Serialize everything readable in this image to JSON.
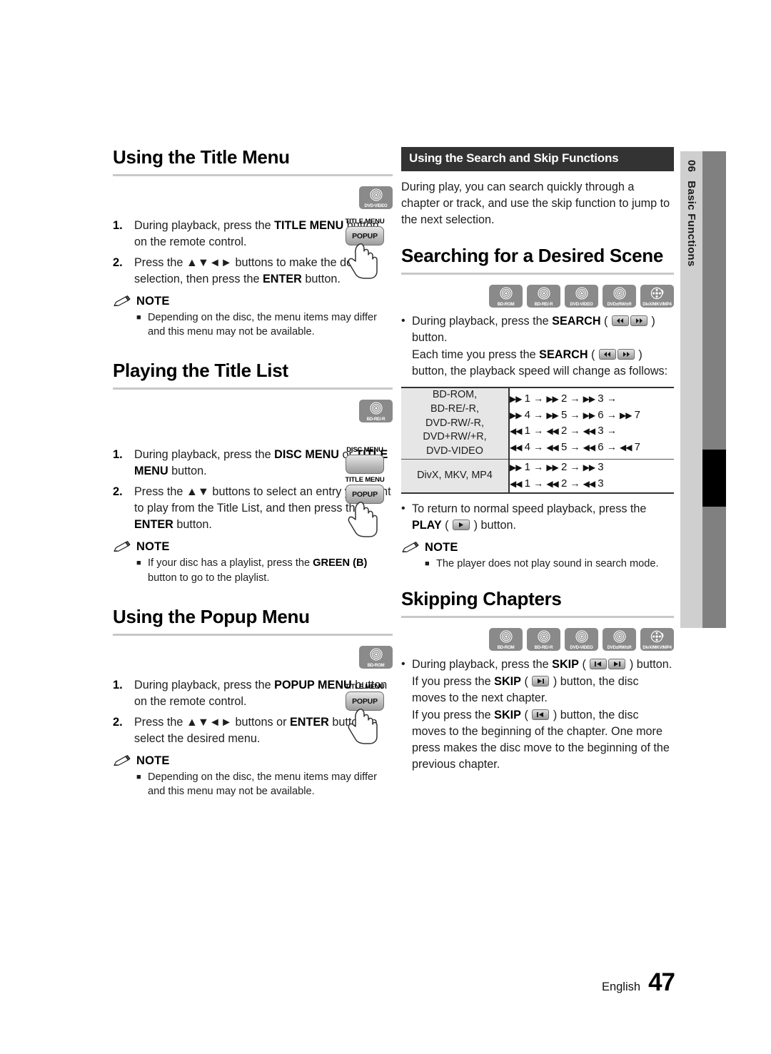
{
  "page": {
    "language": "English",
    "number": "47",
    "chapter_number": "06",
    "chapter_title": "Basic Functions"
  },
  "colors": {
    "banner_bg": "#333333",
    "rule": "#c8c8c8",
    "disc_icon_bg": "#8a8a8a",
    "side_tab_light": "#cfcfcf",
    "side_tab_dark": "#808080",
    "table_label_bg": "#e6e6e6"
  },
  "disc_icons": [
    {
      "name": "bd-rom",
      "caption": "BD-ROM"
    },
    {
      "name": "bd-re-r",
      "caption": "BD-RE/-R"
    },
    {
      "name": "dvd-video",
      "caption": "DVD-VIDEO"
    },
    {
      "name": "dvd-rw-r",
      "caption": "DVD±RW/±R"
    },
    {
      "name": "divx-mkv-mp4",
      "caption": "DivX/MKV/MP4"
    }
  ],
  "note_label": "NOTE",
  "left_column": {
    "section_title_menu": {
      "heading": "Using the Title Menu",
      "disc_icon_caption": "DVD-VIDEO",
      "remote": {
        "label": "TITLE MENU",
        "key": "POPUP"
      },
      "steps": [
        {
          "num": "1.",
          "parts": [
            {
              "t": "During playback, press the ",
              "b": false
            },
            {
              "t": "TITLE MENU",
              "b": true
            },
            {
              "t": " button on the remote control.",
              "b": false
            }
          ]
        },
        {
          "num": "2.",
          "parts": [
            {
              "t": "Press the ",
              "b": false
            },
            {
              "t": "▲▼◄►",
              "b": false
            },
            {
              "t": " buttons to make the desired selection, then press the ",
              "b": false
            },
            {
              "t": "ENTER",
              "b": true
            },
            {
              "t": " button.",
              "b": false
            }
          ]
        }
      ],
      "notes": [
        "Depending on the disc, the menu items may differ and this menu may not be available."
      ]
    },
    "section_title_list": {
      "heading": "Playing the Title List",
      "disc_icon_caption": "BD-RE/-R",
      "remote_top": {
        "label": "DISC MENU",
        "key": ""
      },
      "remote_bottom": {
        "label": "TITLE MENU",
        "key": "POPUP"
      },
      "steps": [
        {
          "num": "1.",
          "parts": [
            {
              "t": "During playback, press the ",
              "b": false
            },
            {
              "t": "DISC MENU",
              "b": true
            },
            {
              "t": " or ",
              "b": false
            },
            {
              "t": "TITLE MENU",
              "b": true
            },
            {
              "t": " button.",
              "b": false
            }
          ]
        },
        {
          "num": "2.",
          "parts": [
            {
              "t": "Press the ",
              "b": false
            },
            {
              "t": "▲▼",
              "b": false
            },
            {
              "t": " buttons to select an entry you want to play from the Title List, and then press the ",
              "b": false
            },
            {
              "t": "ENTER",
              "b": true
            },
            {
              "t": " button.",
              "b": false
            }
          ]
        }
      ],
      "notes_rich": [
        [
          {
            "t": "If your disc has a playlist, press the ",
            "b": false
          },
          {
            "t": "GREEN (B)",
            "b": true
          },
          {
            "t": " button to go to the playlist.",
            "b": false
          }
        ]
      ]
    },
    "section_popup_menu": {
      "heading": "Using the Popup Menu",
      "disc_icon_caption": "BD-ROM",
      "remote": {
        "label": "TITLE MENU",
        "key": "POPUP"
      },
      "steps": [
        {
          "num": "1.",
          "parts": [
            {
              "t": "During playback, press the ",
              "b": false
            },
            {
              "t": "POPUP MENU",
              "b": true
            },
            {
              "t": " button on the remote control.",
              "b": false
            }
          ]
        },
        {
          "num": "2.",
          "parts": [
            {
              "t": "Press the ",
              "b": false
            },
            {
              "t": "▲▼◄►",
              "b": false
            },
            {
              "t": " buttons or ",
              "b": false
            },
            {
              "t": "ENTER",
              "b": true
            },
            {
              "t": " button to select the desired menu.",
              "b": false
            }
          ]
        }
      ],
      "notes": [
        "Depending on the disc, the menu items may differ and this menu may not be available."
      ]
    }
  },
  "right_column": {
    "banner": "Using the Search and Skip Functions",
    "intro": "During play, you can search quickly through a chapter or track, and use the skip function to jump to the next selection.",
    "section_search": {
      "heading": "Searching for a Desired Scene",
      "bullet_1": [
        {
          "t": "During playback, press the ",
          "b": false
        },
        {
          "t": "SEARCH",
          "b": true
        },
        {
          "t": " ( ",
          "b": false
        },
        {
          "t": "[rew][ffw]",
          "b": false
        },
        {
          "t": " ) button.",
          "b": false
        }
      ],
      "sub_1": [
        {
          "t": "Each time you press the ",
          "b": false
        },
        {
          "t": "SEARCH",
          "b": true
        },
        {
          "t": " ( ",
          "b": false
        },
        {
          "t": "[rew][ffw]",
          "b": false
        },
        {
          "t": " ) button, the playback speed will change as follows:",
          "b": false
        }
      ],
      "bullet_2": [
        {
          "t": "To return to normal speed playback, press the ",
          "b": false
        },
        {
          "t": "PLAY",
          "b": true
        },
        {
          "t": " ( ",
          "b": false
        },
        {
          "t": "[play]",
          "b": false
        },
        {
          "t": " ) button.",
          "b": false
        }
      ],
      "notes": [
        "The player does not play sound in search mode."
      ]
    },
    "section_skip": {
      "heading": "Skipping Chapters",
      "bullet_1": [
        {
          "t": "During playback, press the ",
          "b": false
        },
        {
          "t": "SKIP",
          "b": true
        },
        {
          "t": " ( ",
          "b": false
        },
        {
          "t": "[prev][next]",
          "b": false
        },
        {
          "t": " ) button.",
          "b": false
        }
      ],
      "sub_1": [
        {
          "t": "If you press the ",
          "b": false
        },
        {
          "t": "SKIP",
          "b": true
        },
        {
          "t": " ( ",
          "b": false
        },
        {
          "t": "[next]",
          "b": false
        },
        {
          "t": " ) button, the disc moves to the next chapter.",
          "b": false
        }
      ],
      "sub_2": [
        {
          "t": "If you press the ",
          "b": false
        },
        {
          "t": "SKIP",
          "b": true
        },
        {
          "t": " ( ",
          "b": false
        },
        {
          "t": "[prev]",
          "b": false
        },
        {
          "t": " ) button, the disc moves to the beginning of the chapter. One more press makes the disc move to the beginning of the previous chapter.",
          "b": false
        }
      ]
    }
  },
  "speed_table": {
    "rows": [
      {
        "label_lines": [
          "BD-ROM,",
          "BD-RE/-R,",
          "DVD-RW/-R,",
          "DVD+RW/+R,",
          "DVD-VIDEO"
        ],
        "sequences": [
          {
            "dir": "ffw",
            "steps": [
              "1",
              "2",
              "3"
            ],
            "trailing_arrow": true
          },
          {
            "dir": "ffw",
            "steps": [
              "4",
              "5",
              "6",
              "7"
            ],
            "trailing_arrow": false
          },
          {
            "dir": "rew",
            "steps": [
              "1",
              "2",
              "3"
            ],
            "trailing_arrow": true
          },
          {
            "dir": "rew",
            "steps": [
              "4",
              "5",
              "6",
              "7"
            ],
            "trailing_arrow": false
          }
        ]
      },
      {
        "label_lines": [
          "DivX, MKV, MP4"
        ],
        "sequences": [
          {
            "dir": "ffw",
            "steps": [
              "1",
              "2",
              "3"
            ],
            "trailing_arrow": false
          },
          {
            "dir": "rew",
            "steps": [
              "1",
              "2",
              "3"
            ],
            "trailing_arrow": false
          }
        ]
      }
    ]
  }
}
